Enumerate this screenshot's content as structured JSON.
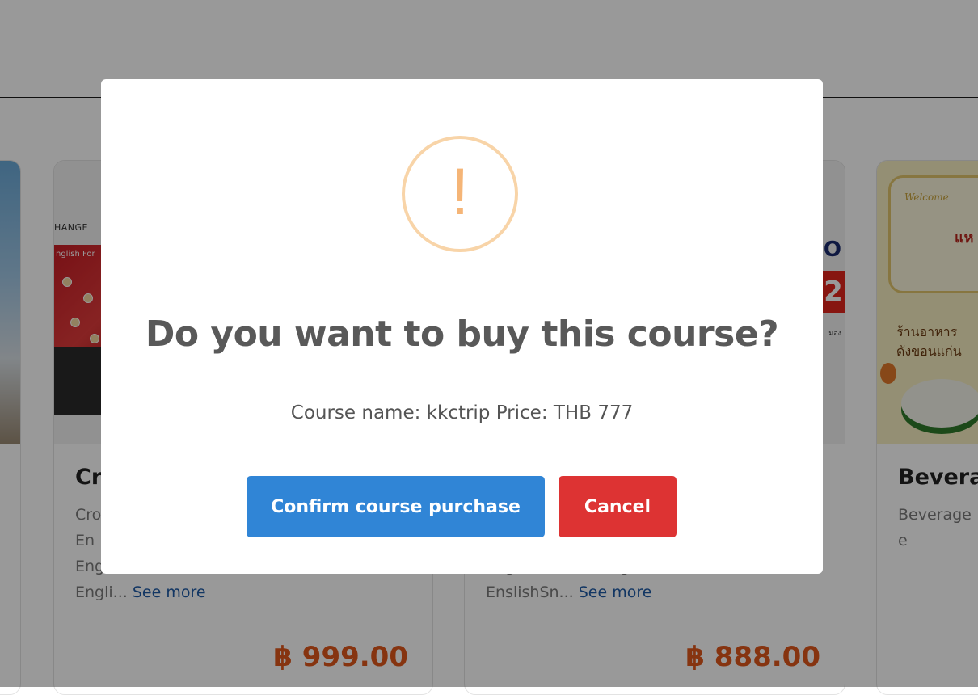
{
  "courses": [
    {
      "title": "Cr",
      "desc_lines": [
        "Cro",
        "En",
        "Engli"
      ],
      "desc_tail": "Engli...",
      "see_more": "See more",
      "price": "฿ 999.00",
      "thumb": {
        "brand": "HANGE",
        "slide_title": "nglish For"
      }
    },
    {
      "title": "",
      "desc_lines": [
        "",
        "",
        "EnglishSnacks EnglishSnacks"
      ],
      "desc_tail": "EnslishSn...",
      "see_more": "See more",
      "price": "฿ 888.00",
      "thumb": {
        "line1": "O",
        "line2": "2",
        "line3": "มอง"
      }
    },
    {
      "title": "Bevera",
      "desc_lines": [
        "Beverage",
        "e"
      ],
      "thumb": {
        "welcome": "Welcome",
        "red_text": "แห",
        "thai_text_1": "ร้านอาหาร",
        "thai_text_2": "ดังขอนแก่น"
      }
    }
  ],
  "modal": {
    "icon": "warning-icon",
    "icon_glyph": "!",
    "title": "Do you want to buy this course?",
    "text": "Course name: kkctrip Price: THB 777",
    "confirm_label": "Confirm course purchase",
    "cancel_label": "Cancel"
  },
  "colors": {
    "confirm": "#3085d6",
    "cancel": "#dd3333",
    "warning": "#f8bb86",
    "price": "#e0571b",
    "see_more": "#1e5aa5"
  }
}
